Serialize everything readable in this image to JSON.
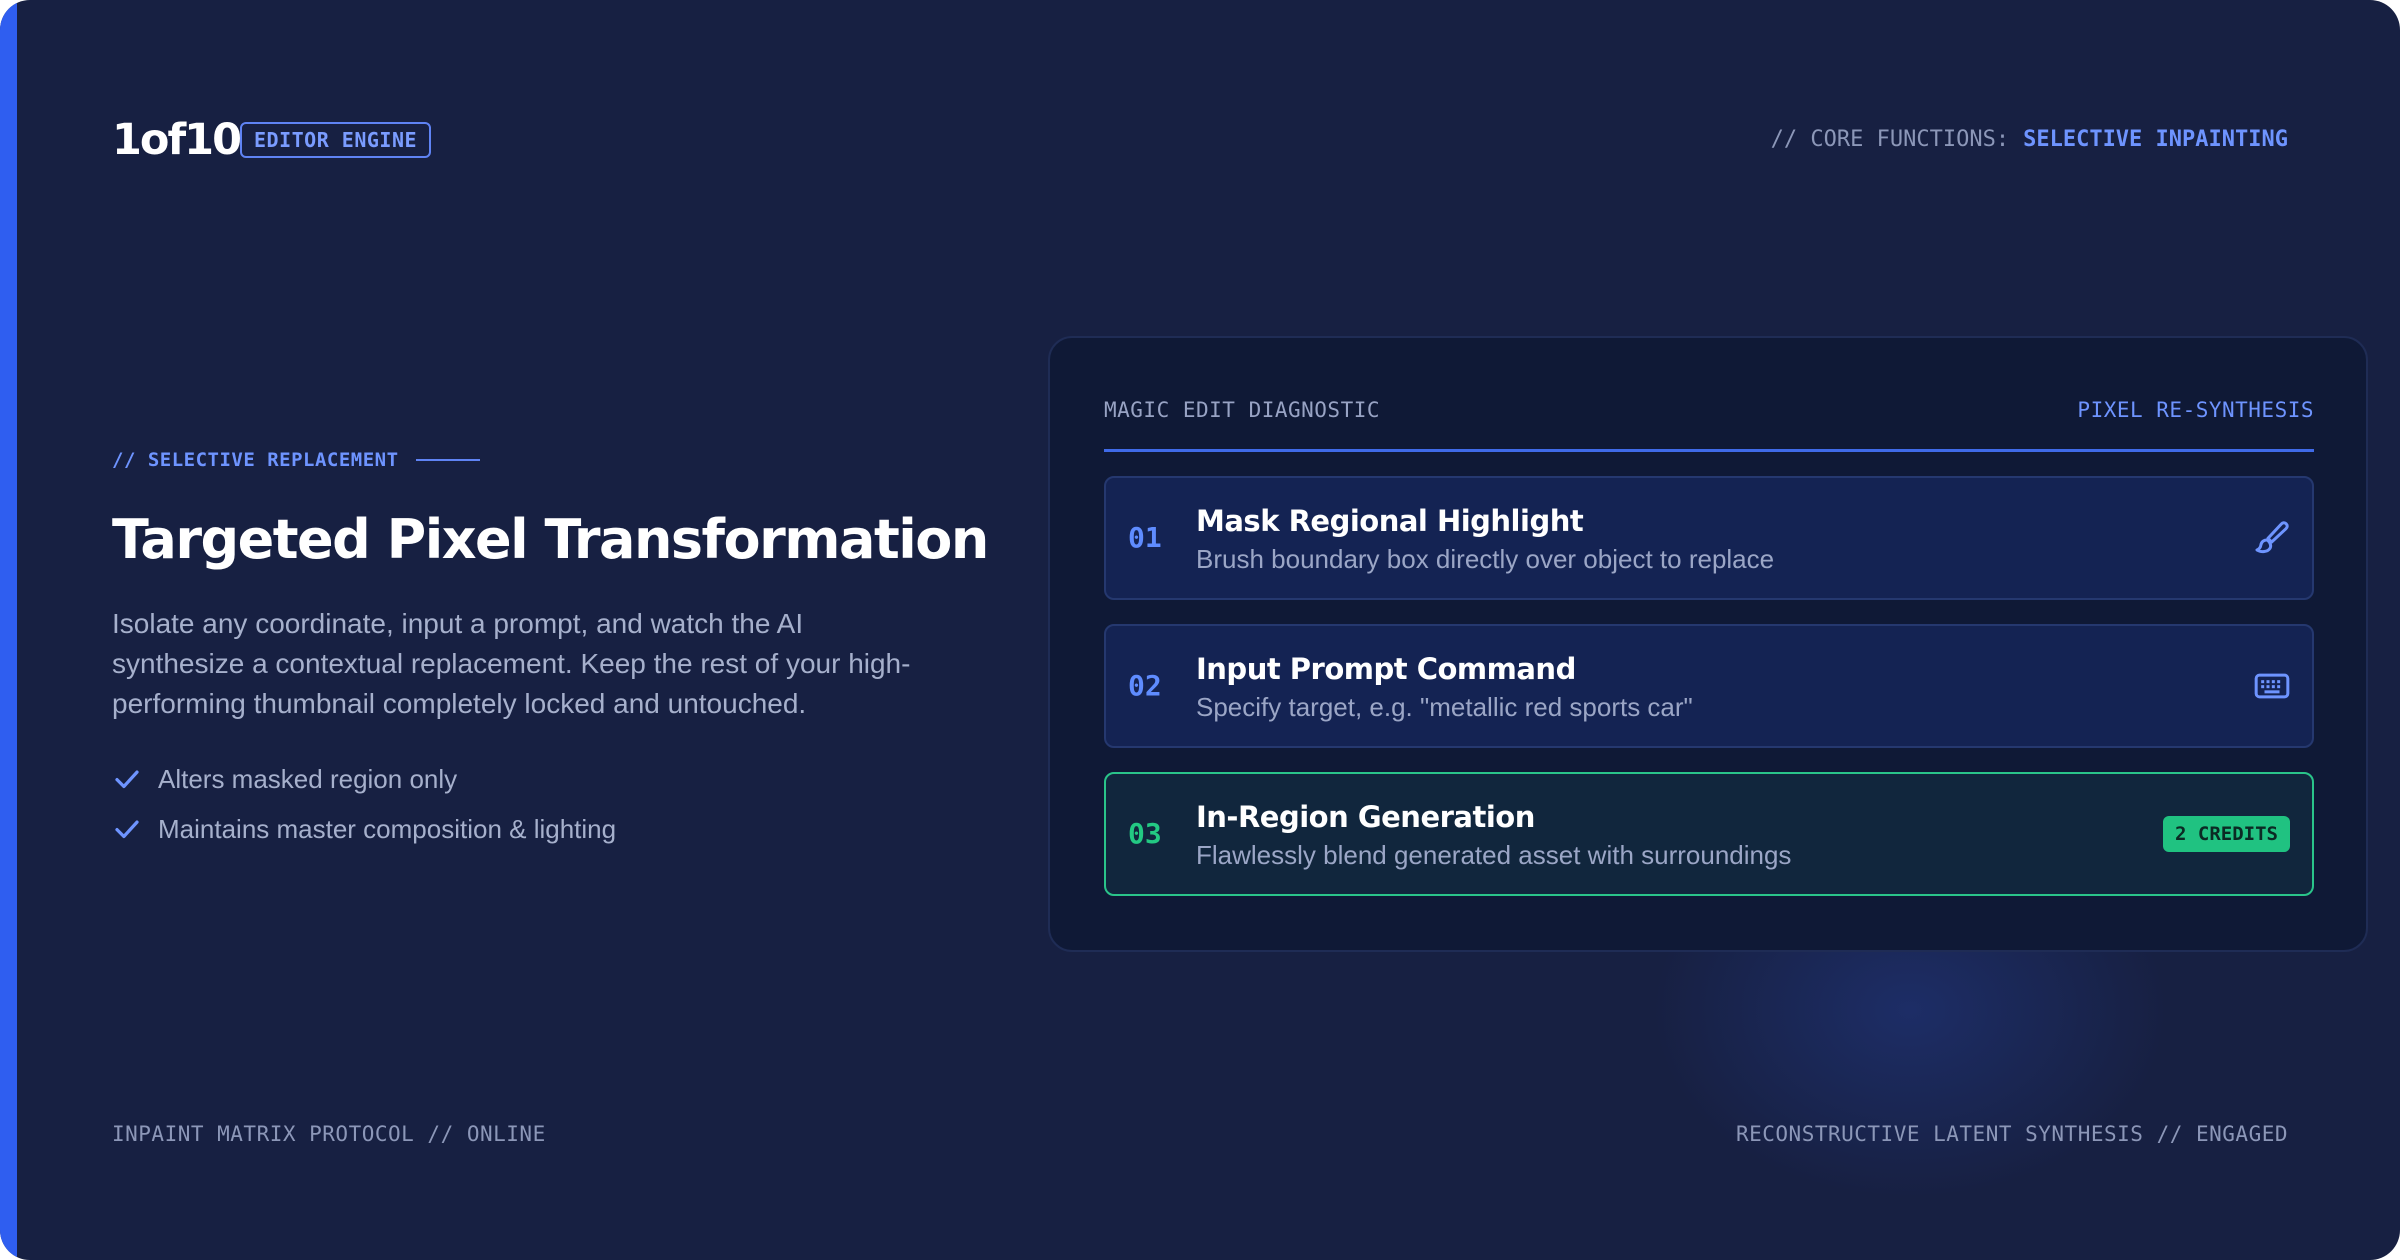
{
  "header": {
    "logo": "1of10",
    "badge": "EDITOR ENGINE",
    "core_functions_label": "// CORE FUNCTIONS:",
    "core_functions_value": "SELECTIVE INPAINTING"
  },
  "hero": {
    "eyebrow": "// SELECTIVE REPLACEMENT",
    "title": "Targeted Pixel Transformation",
    "body": "Isolate any coordinate, input a prompt, and watch the AI synthesize a contextual replacement. Keep the rest of your high-performing thumbnail completely locked and untouched.",
    "checklist": [
      {
        "icon": "check-icon",
        "label": "Alters masked region only"
      },
      {
        "icon": "check-icon",
        "label": "Maintains master composition & lighting"
      }
    ]
  },
  "panel": {
    "title": "MAGIC EDIT DIAGNOSTIC",
    "right_label": "PIXEL RE-SYNTHESIS",
    "steps": [
      {
        "number": "01",
        "title": "Mask Regional Highlight",
        "description": "Brush boundary box directly over object to replace",
        "icon": "brush-icon"
      },
      {
        "number": "02",
        "title": "Input Prompt Command",
        "description": "Specify target, e.g. \"metallic red sports car\"",
        "icon": "keyboard-icon"
      },
      {
        "number": "03",
        "title": "In-Region Generation",
        "description": "Flawlessly blend generated asset with surroundings",
        "badge": "2 CREDITS"
      }
    ]
  },
  "footer": {
    "left": "INPAINT MATRIX PROTOCOL // ONLINE",
    "right": "RECONSTRUCTIVE LATENT SYNTHESIS // ENGAGED"
  },
  "colors": {
    "background": "#172042",
    "accent": "#2f5ef0",
    "highlight": "#6e94ff",
    "success": "#20c281"
  }
}
